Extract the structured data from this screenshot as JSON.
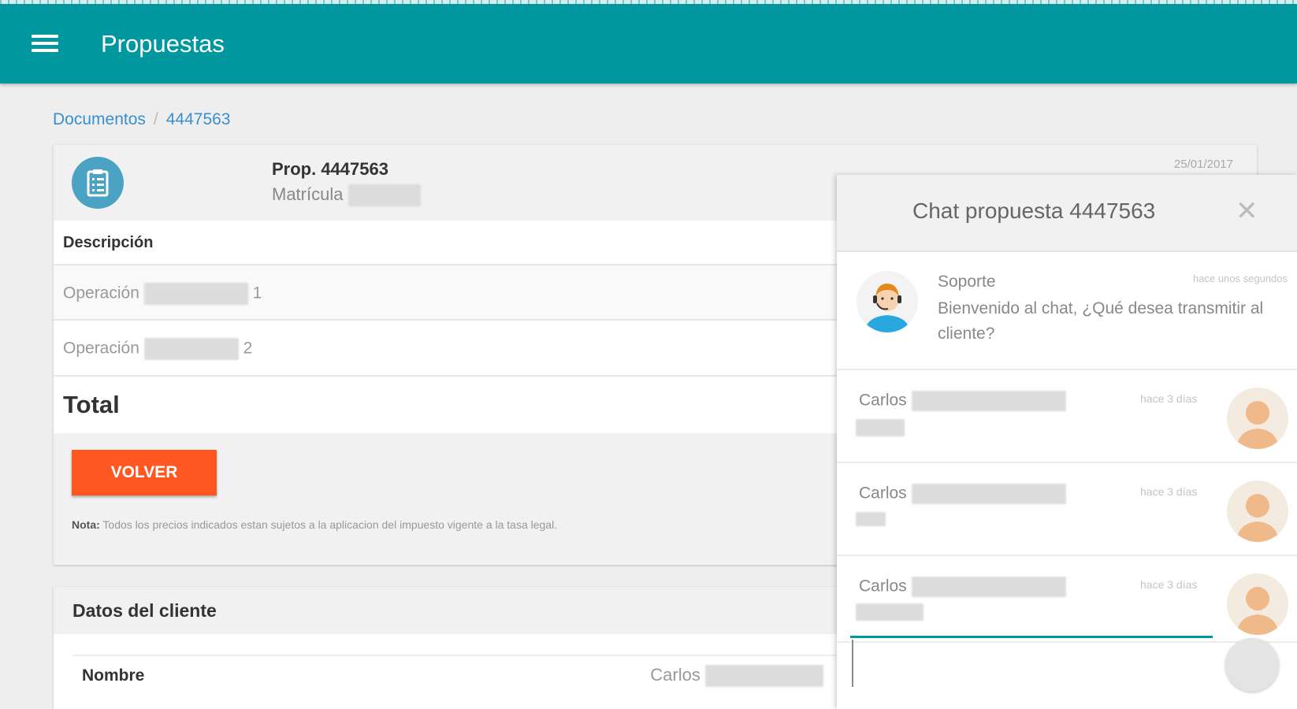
{
  "header": {
    "title": "Propuestas",
    "menu_icon": "hamburger-menu-icon",
    "bg_color": "#00979f"
  },
  "breadcrumb": {
    "root": "Documentos",
    "separator": "/",
    "current": "4447563"
  },
  "proposal": {
    "title": "Prop. 4447563",
    "matricula_label": "Matrícula",
    "date": "25/01/2017",
    "description_header": "Descripción",
    "operations": [
      {
        "label": "Operación",
        "suffix": "1"
      },
      {
        "label": "Operación",
        "suffix": "2"
      }
    ],
    "total_label": "Total",
    "back_button": "VOLVER",
    "note_label": "Nota:",
    "note_text": " Todos los precios indicados estan sujetos a la aplicacion del impuesto vigente a la tasa legal."
  },
  "client": {
    "section_title": "Datos del cliente",
    "name_label": "Nombre",
    "name_value": "Carlos"
  },
  "chat": {
    "title": "Chat propuesta 4447563",
    "messages": [
      {
        "sender": "Soporte",
        "time": "hace unos segundos",
        "text": "Bienvenido al chat, ¿Qué desea transmitir al cliente?"
      },
      {
        "sender": "Carlos",
        "time": "hace 3 días"
      },
      {
        "sender": "Carlos",
        "time": "hace 3 días"
      },
      {
        "sender": "Carlos",
        "time": "hace 3 días"
      }
    ],
    "input_value": ""
  },
  "colors": {
    "accent": "#00979f",
    "button": "#ff5722",
    "link": "#3a8fd0"
  }
}
